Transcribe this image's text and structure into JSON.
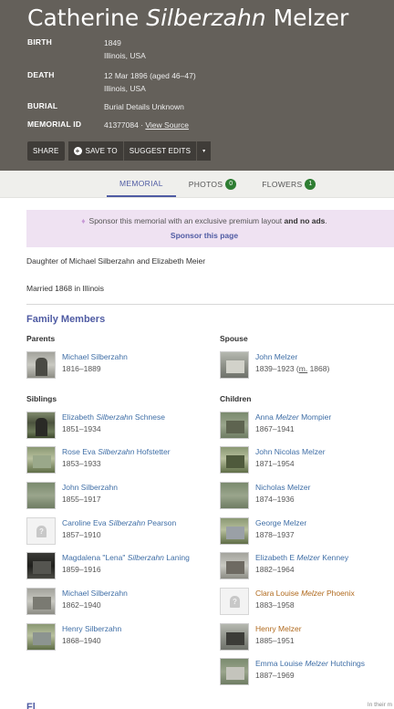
{
  "header": {
    "first": "Catherine",
    "middle": "Silberzahn",
    "last": "Melzer",
    "birth_label": "BIRTH",
    "birth_date": "1849",
    "birth_place": "Illinois, USA",
    "death_label": "DEATH",
    "death_date": "12 Mar 1896 (aged 46–47)",
    "death_place": "Illinois, USA",
    "burial_label": "BURIAL",
    "burial_value": "Burial Details Unknown",
    "memorial_label": "MEMORIAL ID",
    "memorial_id": "41377084",
    "memorial_sep": " · ",
    "view_source": "View Source"
  },
  "actions": {
    "share": "SHARE",
    "save_to": "SAVE TO",
    "suggest_edits": "SUGGEST EDITS",
    "more": "▾"
  },
  "tabs": [
    {
      "label": "MEMORIAL",
      "count": ""
    },
    {
      "label": "PHOTOS",
      "count": "0"
    },
    {
      "label": "FLOWERS",
      "count": "1"
    }
  ],
  "sponsor": {
    "text_before": "Sponsor this memorial with an exclusive premium layout ",
    "text_bold": "and no ads",
    "text_after": ".",
    "link": "Sponsor this page"
  },
  "bio": {
    "line1": "Daughter of Michael Silberzahn and Elizabeth Meier",
    "line2": "Married 1868 in Illinois"
  },
  "family": {
    "heading": "Family Members",
    "parents_title": "Parents",
    "spouse_title": "Spouse",
    "siblings_title": "Siblings",
    "children_title": "Children",
    "parents": [
      {
        "name": "Michael Silberzahn",
        "dates": "1816–1889"
      }
    ],
    "spouse": [
      {
        "name": "John Melzer",
        "dates": "1839–1923",
        "marriage": "m.",
        "marriage_year": " 1868)"
      }
    ],
    "siblings": [
      {
        "pre": "Elizabeth ",
        "maiden": "Silberzahn",
        "post": " Schnese",
        "dates": "1851–1934"
      },
      {
        "pre": "Rose Eva ",
        "maiden": "Silberzahn",
        "post": " Hofstetter",
        "dates": "1853–1933"
      },
      {
        "pre": "John Silberzahn",
        "maiden": "",
        "post": "",
        "dates": "1855–1917"
      },
      {
        "pre": "Caroline Eva ",
        "maiden": "Silberzahn",
        "post": " Pearson",
        "dates": "1857–1910"
      },
      {
        "pre": "Magdalena \"Lena\" ",
        "maiden": "Silberzahn",
        "post": " Laning",
        "dates": "1859–1916"
      },
      {
        "pre": "Michael Silberzahn",
        "maiden": "",
        "post": "",
        "dates": "1862–1940"
      },
      {
        "pre": "Henry Silberzahn",
        "maiden": "",
        "post": "",
        "dates": "1868–1940"
      }
    ],
    "children": [
      {
        "pre": "Anna ",
        "maiden": "Melzer",
        "post": " Mompier",
        "dates": "1867–1941"
      },
      {
        "pre": "John Nicolas Melzer",
        "maiden": "",
        "post": "",
        "dates": "1871–1954"
      },
      {
        "pre": "Nicholas Melzer",
        "maiden": "",
        "post": "",
        "dates": "1874–1936"
      },
      {
        "pre": "George Melzer",
        "maiden": "",
        "post": "",
        "dates": "1878–1937"
      },
      {
        "pre": "Elizabeth E ",
        "maiden": "Melzer",
        "post": " Kenney",
        "dates": "1882–1964"
      },
      {
        "pre": "Clara Louise ",
        "maiden": "Melzer",
        "post": " Phoenix",
        "dates": "1883–1958"
      },
      {
        "pre": "Henry Melzer",
        "maiden": "",
        "post": "",
        "dates": "1885–1951"
      },
      {
        "pre": "Emma Louise ",
        "maiden": "Melzer",
        "post": " Hutchings",
        "dates": "1887–1969"
      }
    ]
  },
  "footer": {
    "note": "In their m",
    "cut_heading": "Fl"
  },
  "colors": {
    "header_bg": "#64605a",
    "link": "#3f6ea6",
    "accent": "#4f5ba3",
    "badge": "#2e7d32",
    "sponsor_bg": "#efe2f2",
    "visited_link": "#b06a1e"
  }
}
